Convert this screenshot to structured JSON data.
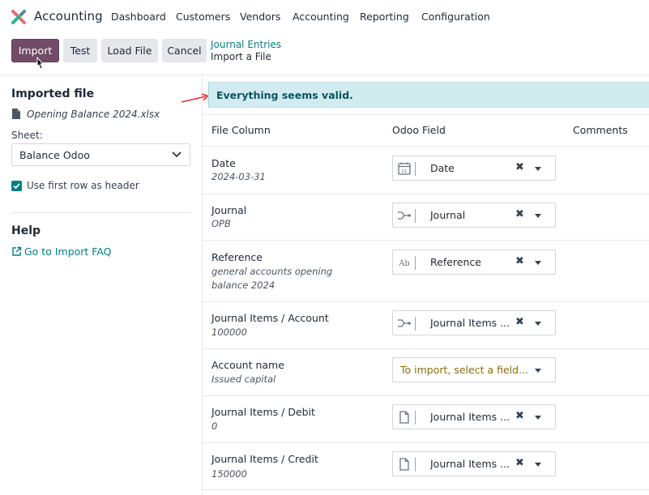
{
  "app": {
    "name": "Accounting"
  },
  "nav": [
    "Dashboard",
    "Customers",
    "Vendors",
    "Accounting",
    "Reporting",
    "Configuration"
  ],
  "toolbar": {
    "import_label": "Import",
    "test_label": "Test",
    "load_file_label": "Load File",
    "cancel_label": "Cancel"
  },
  "breadcrumb": {
    "parent": "Journal Entries",
    "current": "Import a File"
  },
  "sidebar": {
    "imported_heading": "Imported file",
    "file_name": "Opening Balance 2024.xlsx",
    "sheet_label": "Sheet:",
    "sheet_value": "Balance Odoo",
    "first_row_header": "Use first row as header",
    "help_heading": "Help",
    "faq_link": "Go to Import FAQ"
  },
  "banner": {
    "message": "Everything seems valid."
  },
  "table": {
    "headers": {
      "file_column": "File Column",
      "odoo_field": "Odoo Field",
      "comments": "Comments"
    },
    "rows": [
      {
        "name": "Date",
        "sample": "2024-03-31",
        "field": "Date",
        "icon": "calendar-icon"
      },
      {
        "name": "Journal",
        "sample": "OPB",
        "field": "Journal",
        "icon": "relation-icon"
      },
      {
        "name": "Reference",
        "sample": "general accounts opening balance 2024",
        "field": "Reference",
        "icon": "text-field-icon"
      },
      {
        "name": "Journal Items / Account",
        "sample": "100000",
        "field": "Journal Items ...",
        "icon": "relation-icon"
      },
      {
        "name": "Account name",
        "sample": "Issued capital",
        "placeholder": "To import, select a field...",
        "icon": ""
      },
      {
        "name": "Journal Items / Debit",
        "sample": "0",
        "field": "Journal Items ...",
        "icon": "document-icon"
      },
      {
        "name": "Journal Items / Credit",
        "sample": "150000",
        "field": "Journal Items ...",
        "icon": "document-icon"
      }
    ]
  },
  "colors": {
    "primary": "#714b67",
    "link": "#017e84",
    "banner_bg": "#d1ecf1",
    "banner_text": "#0c5460",
    "warning_text": "#8a6d0a"
  }
}
